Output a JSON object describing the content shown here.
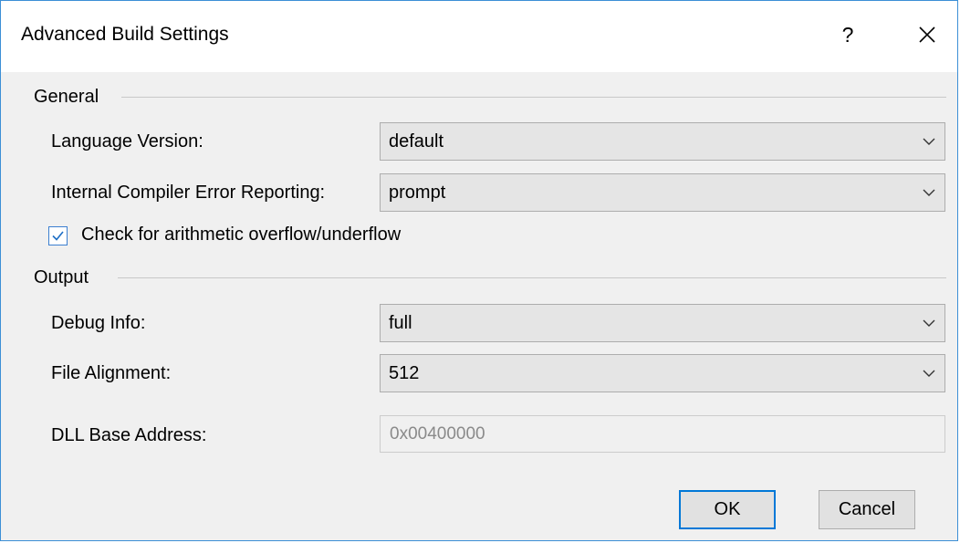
{
  "dialog": {
    "title": "Advanced Build Settings",
    "help_label": "?",
    "close_icon": "close-icon"
  },
  "general": {
    "title": "General",
    "language_version": {
      "label": "Language Version:",
      "value": "default"
    },
    "error_reporting": {
      "label": "Internal Compiler Error Reporting:",
      "value": "prompt"
    },
    "overflow_check": {
      "label": "Check for arithmetic overflow/underflow",
      "checked": true
    }
  },
  "output": {
    "title": "Output",
    "debug_info": {
      "label": "Debug Info:",
      "value": "full"
    },
    "file_alignment": {
      "label": "File Alignment:",
      "value": "512"
    },
    "dll_base_address": {
      "label": "DLL Base Address:",
      "value": "0x00400000"
    }
  },
  "buttons": {
    "ok": "OK",
    "cancel": "Cancel"
  },
  "colors": {
    "accent": "#0078d7",
    "dialog_background": "#f0f0f0",
    "combo_background": "#e5e5e5"
  }
}
